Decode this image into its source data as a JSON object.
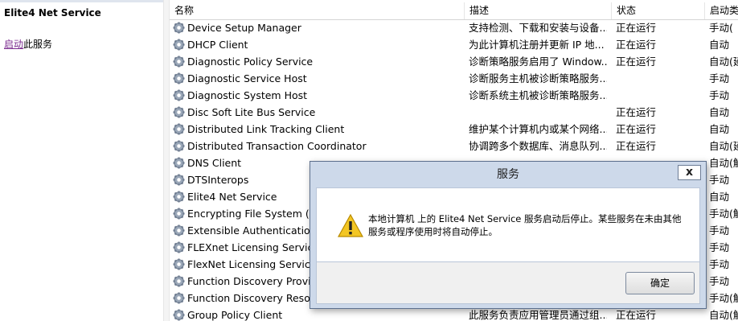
{
  "left_panel": {
    "title": "Elite4 Net Service",
    "start_link": "启动",
    "start_suffix": "此服务"
  },
  "columns": {
    "name": "名称",
    "description": "描述",
    "status": "状态",
    "startup": "启动类"
  },
  "services": [
    {
      "name": "Device Setup Manager",
      "desc": "支持检测、下载和安装与设备...",
      "status": "正在运行",
      "startup": "手动("
    },
    {
      "name": "DHCP Client",
      "desc": "为此计算机注册并更新 IP 地...",
      "status": "正在运行",
      "startup": "自动"
    },
    {
      "name": "Diagnostic Policy Service",
      "desc": "诊断策略服务启用了 Window...",
      "status": "正在运行",
      "startup": "自动(延"
    },
    {
      "name": "Diagnostic Service Host",
      "desc": "诊断服务主机被诊断策略服务...",
      "status": "",
      "startup": "手动"
    },
    {
      "name": "Diagnostic System Host",
      "desc": "诊断系统主机被诊断策略服务...",
      "status": "",
      "startup": "手动"
    },
    {
      "name": "Disc Soft Lite Bus Service",
      "desc": "",
      "status": "正在运行",
      "startup": "自动"
    },
    {
      "name": "Distributed Link Tracking Client",
      "desc": "维护某个计算机内或某个网络...",
      "status": "正在运行",
      "startup": "自动"
    },
    {
      "name": "Distributed Transaction Coordinator",
      "desc": "协调跨多个数据库、消息队列...",
      "status": "正在运行",
      "startup": "自动(延"
    },
    {
      "name": "DNS Client",
      "desc": "",
      "status": "",
      "startup": "自动(触"
    },
    {
      "name": "DTSInterops",
      "desc": "",
      "status": "",
      "startup": "手动"
    },
    {
      "name": "Elite4 Net Service",
      "desc": "",
      "status": "",
      "startup": "自动"
    },
    {
      "name": "Encrypting File System (EFS)",
      "desc": "",
      "status": "",
      "startup": "手动(触"
    },
    {
      "name": "Extensible Authentication Protocol",
      "desc": "",
      "status": "",
      "startup": "手动"
    },
    {
      "name": "FLEXnet Licensing Service",
      "desc": "",
      "status": "",
      "startup": "手动"
    },
    {
      "name": "FlexNet Licensing Service 64",
      "desc": "",
      "status": "",
      "startup": "手动"
    },
    {
      "name": "Function Discovery Provider Host",
      "desc": "",
      "status": "",
      "startup": "手动"
    },
    {
      "name": "Function Discovery Resource Publication",
      "desc": "",
      "status": "",
      "startup": "手动(触"
    },
    {
      "name": "Group Policy Client",
      "desc": "此服务负责应用管理员通过组...",
      "status": "正在运行",
      "startup": "自动(触"
    }
  ],
  "dialog": {
    "title": "服务",
    "message": "本地计算机 上的 Elite4 Net Service 服务启动后停止。某些服务在未由其他服务或程序使用时将自动停止。",
    "ok_label": "确定",
    "close_glyph": "x"
  },
  "icons": {
    "service": "gear-icon",
    "warning": "warning-icon"
  }
}
